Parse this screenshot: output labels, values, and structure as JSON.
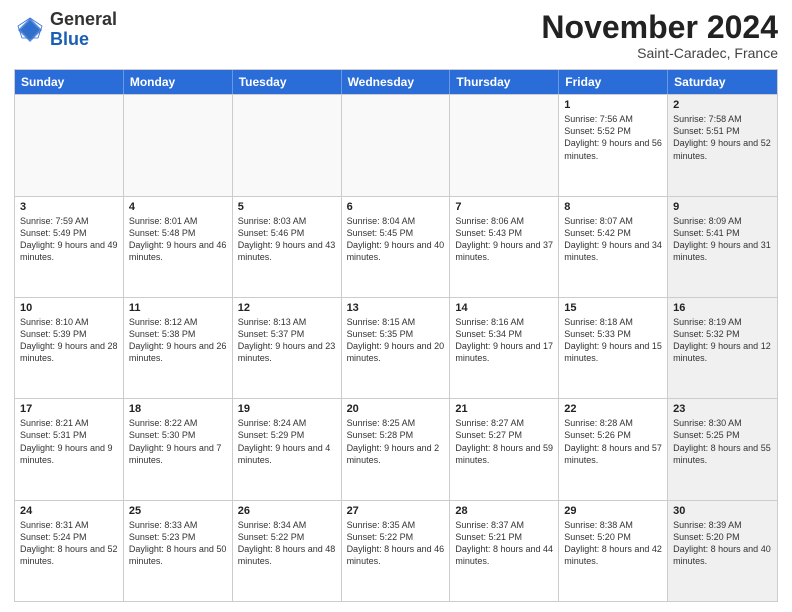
{
  "logo": {
    "general": "General",
    "blue": "Blue"
  },
  "header": {
    "month": "November 2024",
    "location": "Saint-Caradec, France"
  },
  "weekdays": [
    "Sunday",
    "Monday",
    "Tuesday",
    "Wednesday",
    "Thursday",
    "Friday",
    "Saturday"
  ],
  "rows": [
    [
      {
        "day": "",
        "info": "",
        "shaded": false,
        "empty": true
      },
      {
        "day": "",
        "info": "",
        "shaded": false,
        "empty": true
      },
      {
        "day": "",
        "info": "",
        "shaded": false,
        "empty": true
      },
      {
        "day": "",
        "info": "",
        "shaded": false,
        "empty": true
      },
      {
        "day": "",
        "info": "",
        "shaded": false,
        "empty": true
      },
      {
        "day": "1",
        "info": "Sunrise: 7:56 AM\nSunset: 5:52 PM\nDaylight: 9 hours and 56 minutes.",
        "shaded": false,
        "empty": false
      },
      {
        "day": "2",
        "info": "Sunrise: 7:58 AM\nSunset: 5:51 PM\nDaylight: 9 hours and 52 minutes.",
        "shaded": true,
        "empty": false
      }
    ],
    [
      {
        "day": "3",
        "info": "Sunrise: 7:59 AM\nSunset: 5:49 PM\nDaylight: 9 hours and 49 minutes.",
        "shaded": false,
        "empty": false
      },
      {
        "day": "4",
        "info": "Sunrise: 8:01 AM\nSunset: 5:48 PM\nDaylight: 9 hours and 46 minutes.",
        "shaded": false,
        "empty": false
      },
      {
        "day": "5",
        "info": "Sunrise: 8:03 AM\nSunset: 5:46 PM\nDaylight: 9 hours and 43 minutes.",
        "shaded": false,
        "empty": false
      },
      {
        "day": "6",
        "info": "Sunrise: 8:04 AM\nSunset: 5:45 PM\nDaylight: 9 hours and 40 minutes.",
        "shaded": false,
        "empty": false
      },
      {
        "day": "7",
        "info": "Sunrise: 8:06 AM\nSunset: 5:43 PM\nDaylight: 9 hours and 37 minutes.",
        "shaded": false,
        "empty": false
      },
      {
        "day": "8",
        "info": "Sunrise: 8:07 AM\nSunset: 5:42 PM\nDaylight: 9 hours and 34 minutes.",
        "shaded": false,
        "empty": false
      },
      {
        "day": "9",
        "info": "Sunrise: 8:09 AM\nSunset: 5:41 PM\nDaylight: 9 hours and 31 minutes.",
        "shaded": true,
        "empty": false
      }
    ],
    [
      {
        "day": "10",
        "info": "Sunrise: 8:10 AM\nSunset: 5:39 PM\nDaylight: 9 hours and 28 minutes.",
        "shaded": false,
        "empty": false
      },
      {
        "day": "11",
        "info": "Sunrise: 8:12 AM\nSunset: 5:38 PM\nDaylight: 9 hours and 26 minutes.",
        "shaded": false,
        "empty": false
      },
      {
        "day": "12",
        "info": "Sunrise: 8:13 AM\nSunset: 5:37 PM\nDaylight: 9 hours and 23 minutes.",
        "shaded": false,
        "empty": false
      },
      {
        "day": "13",
        "info": "Sunrise: 8:15 AM\nSunset: 5:35 PM\nDaylight: 9 hours and 20 minutes.",
        "shaded": false,
        "empty": false
      },
      {
        "day": "14",
        "info": "Sunrise: 8:16 AM\nSunset: 5:34 PM\nDaylight: 9 hours and 17 minutes.",
        "shaded": false,
        "empty": false
      },
      {
        "day": "15",
        "info": "Sunrise: 8:18 AM\nSunset: 5:33 PM\nDaylight: 9 hours and 15 minutes.",
        "shaded": false,
        "empty": false
      },
      {
        "day": "16",
        "info": "Sunrise: 8:19 AM\nSunset: 5:32 PM\nDaylight: 9 hours and 12 minutes.",
        "shaded": true,
        "empty": false
      }
    ],
    [
      {
        "day": "17",
        "info": "Sunrise: 8:21 AM\nSunset: 5:31 PM\nDaylight: 9 hours and 9 minutes.",
        "shaded": false,
        "empty": false
      },
      {
        "day": "18",
        "info": "Sunrise: 8:22 AM\nSunset: 5:30 PM\nDaylight: 9 hours and 7 minutes.",
        "shaded": false,
        "empty": false
      },
      {
        "day": "19",
        "info": "Sunrise: 8:24 AM\nSunset: 5:29 PM\nDaylight: 9 hours and 4 minutes.",
        "shaded": false,
        "empty": false
      },
      {
        "day": "20",
        "info": "Sunrise: 8:25 AM\nSunset: 5:28 PM\nDaylight: 9 hours and 2 minutes.",
        "shaded": false,
        "empty": false
      },
      {
        "day": "21",
        "info": "Sunrise: 8:27 AM\nSunset: 5:27 PM\nDaylight: 8 hours and 59 minutes.",
        "shaded": false,
        "empty": false
      },
      {
        "day": "22",
        "info": "Sunrise: 8:28 AM\nSunset: 5:26 PM\nDaylight: 8 hours and 57 minutes.",
        "shaded": false,
        "empty": false
      },
      {
        "day": "23",
        "info": "Sunrise: 8:30 AM\nSunset: 5:25 PM\nDaylight: 8 hours and 55 minutes.",
        "shaded": true,
        "empty": false
      }
    ],
    [
      {
        "day": "24",
        "info": "Sunrise: 8:31 AM\nSunset: 5:24 PM\nDaylight: 8 hours and 52 minutes.",
        "shaded": false,
        "empty": false
      },
      {
        "day": "25",
        "info": "Sunrise: 8:33 AM\nSunset: 5:23 PM\nDaylight: 8 hours and 50 minutes.",
        "shaded": false,
        "empty": false
      },
      {
        "day": "26",
        "info": "Sunrise: 8:34 AM\nSunset: 5:22 PM\nDaylight: 8 hours and 48 minutes.",
        "shaded": false,
        "empty": false
      },
      {
        "day": "27",
        "info": "Sunrise: 8:35 AM\nSunset: 5:22 PM\nDaylight: 8 hours and 46 minutes.",
        "shaded": false,
        "empty": false
      },
      {
        "day": "28",
        "info": "Sunrise: 8:37 AM\nSunset: 5:21 PM\nDaylight: 8 hours and 44 minutes.",
        "shaded": false,
        "empty": false
      },
      {
        "day": "29",
        "info": "Sunrise: 8:38 AM\nSunset: 5:20 PM\nDaylight: 8 hours and 42 minutes.",
        "shaded": false,
        "empty": false
      },
      {
        "day": "30",
        "info": "Sunrise: 8:39 AM\nSunset: 5:20 PM\nDaylight: 8 hours and 40 minutes.",
        "shaded": true,
        "empty": false
      }
    ]
  ]
}
